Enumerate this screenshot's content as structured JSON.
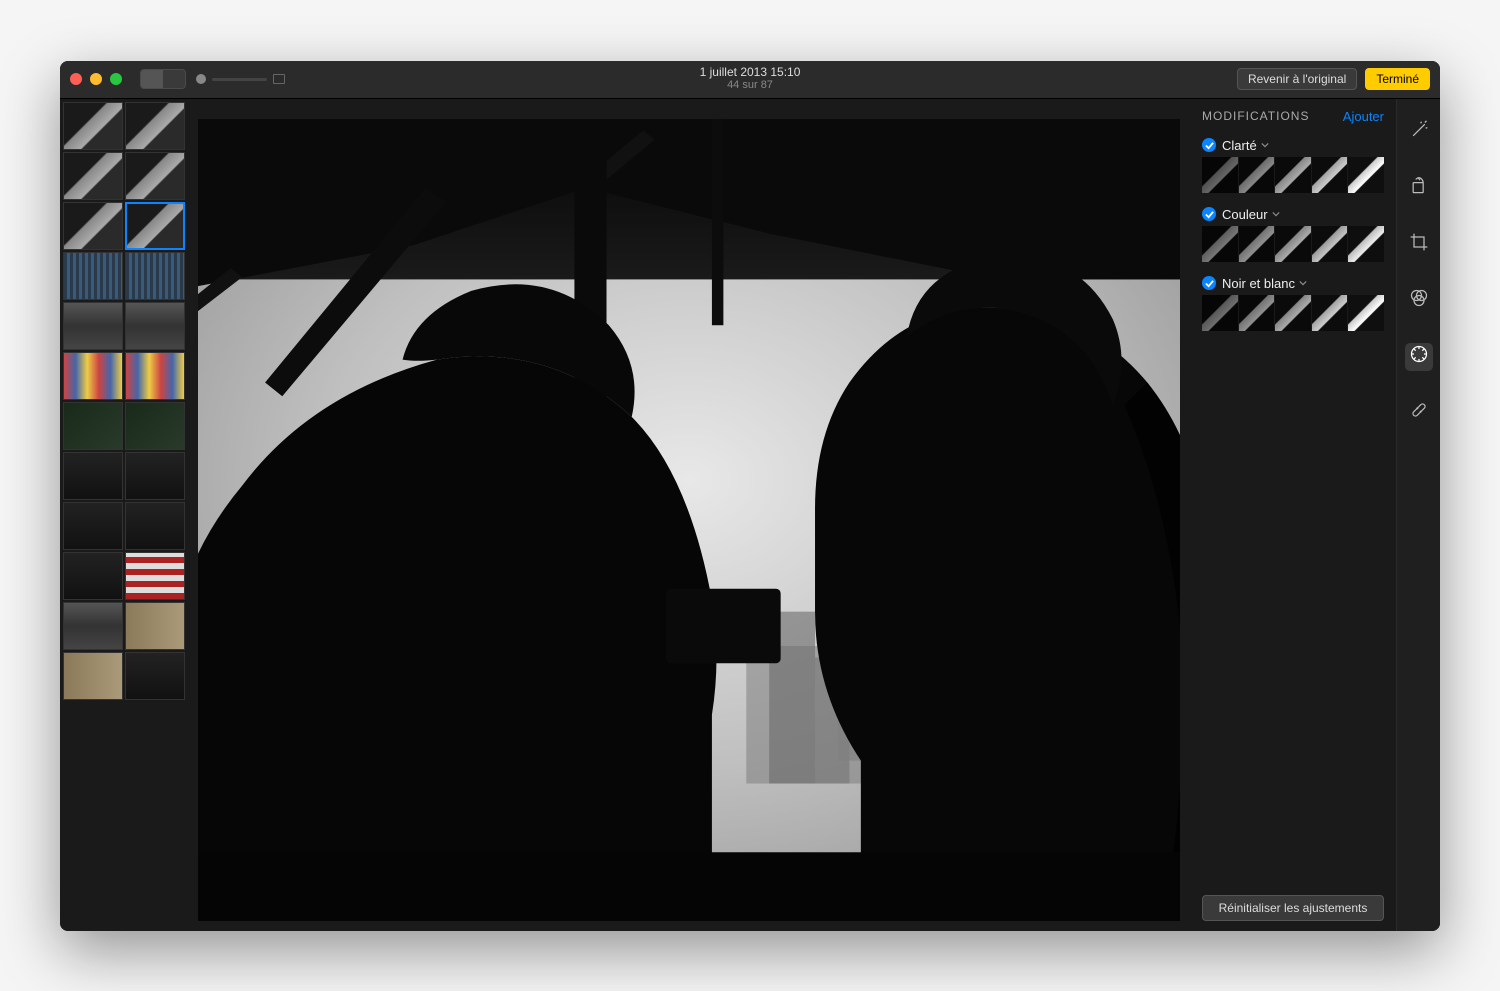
{
  "header": {
    "title": "1 juillet 2013 15:10",
    "subtitle": "44 sur 87",
    "revert_button": "Revenir à l'original",
    "done_button": "Terminé"
  },
  "panel": {
    "title": "MODIFICATIONS",
    "add_label": "Ajouter",
    "reset_label": "Réinitialiser les ajustements",
    "adjustments": [
      {
        "label": "Clarté",
        "enabled": true
      },
      {
        "label": "Couleur",
        "enabled": true
      },
      {
        "label": "Noir et blanc",
        "enabled": true
      }
    ]
  },
  "tools": [
    {
      "name": "magic-wand",
      "active": false
    },
    {
      "name": "rotate",
      "active": false
    },
    {
      "name": "crop",
      "active": false
    },
    {
      "name": "filters",
      "active": false
    },
    {
      "name": "adjust",
      "active": true
    },
    {
      "name": "retouch",
      "active": false
    }
  ],
  "thumbnails": {
    "selected_index": 3
  }
}
